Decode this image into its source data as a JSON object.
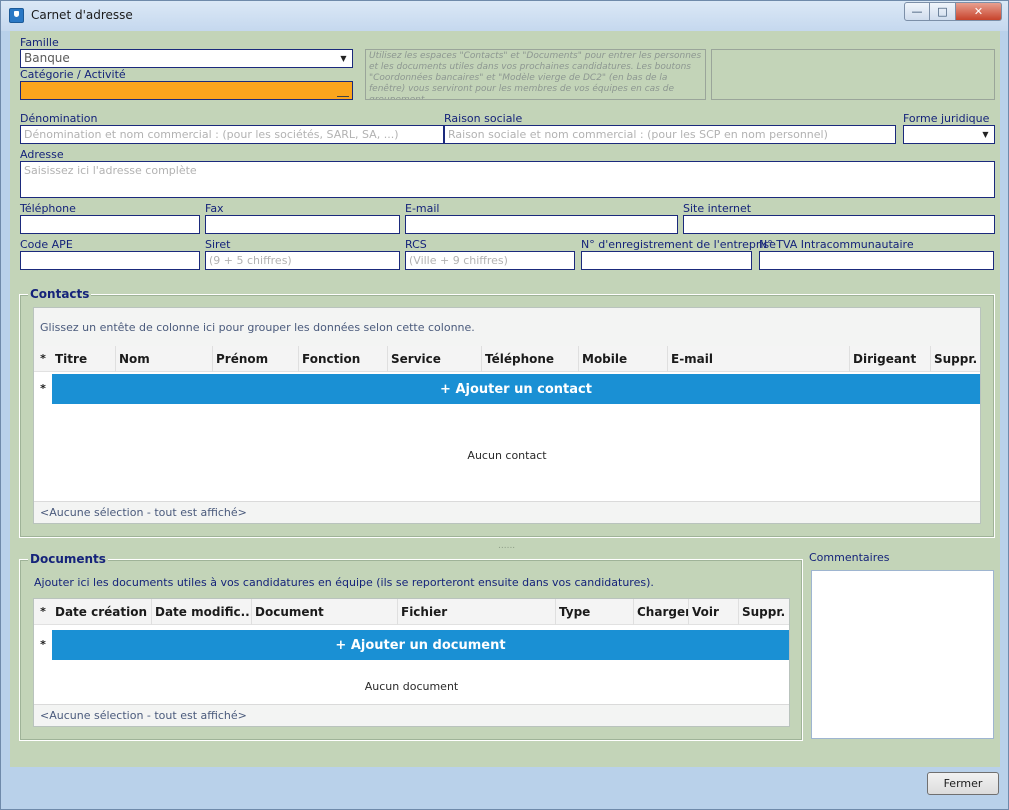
{
  "window": {
    "title": "Carnet d'adresse",
    "close_glyph": "✕",
    "minimize_glyph": "—",
    "maximize_glyph": "□"
  },
  "form": {
    "famille_label": "Famille",
    "famille_value": "Banque",
    "categorie_label": "Catégorie / Activité",
    "info_text": "Utilisez les espaces \"Contacts\" et \"Documents\" pour entrer les personnes et les documents utiles dans vos prochaines candidatures. Les boutons \"Coordonnées bancaires\" et \"Modèle vierge de DC2\" (en bas de la fenêtre) vous serviront pour les membres de vos équipes en cas de groupement.",
    "denomination_label": "Dénomination",
    "denomination_placeholder": "Dénomination et nom commercial :  (pour les sociétés, SARL, SA, ...)",
    "raison_label": "Raison sociale",
    "raison_placeholder": "Raison sociale et nom commercial : (pour les SCP en nom personnel)",
    "forme_label": "Forme juridique",
    "adresse_label": "Adresse",
    "adresse_placeholder": "Saisissez ici l'adresse complète",
    "telephone_label": "Téléphone",
    "fax_label": "Fax",
    "email_label": "E-mail",
    "site_label": "Site internet",
    "ape_label": "Code APE",
    "siret_label": "Siret",
    "siret_placeholder": "(9 + 5 chiffres)",
    "rcs_label": "RCS",
    "rcs_placeholder": "(Ville + 9 chiffres)",
    "enregistrement_label": "N° d'enregistrement de l'entreprise",
    "tva_label": "N° TVA Intracommunautaire"
  },
  "contacts": {
    "title": "Contacts",
    "hint": "Glissez un entête de colonne ici pour grouper les données selon cette colonne.",
    "star": "*",
    "columns": [
      "Titre",
      "Nom",
      "Prénom",
      "Fonction",
      "Service",
      "Téléphone",
      "Mobile",
      "E-mail",
      "Dirigeant",
      "Suppr."
    ],
    "add_label": "+ Ajouter un contact",
    "empty": "Aucun contact",
    "footer": "<Aucune sélection - tout est affiché>"
  },
  "documents": {
    "title": "Documents",
    "hint": "Ajouter ici les documents utiles à vos candidatures en équipe (ils se reporteront ensuite dans vos candidatures).",
    "star": "*",
    "columns": [
      "Date création",
      "Date modific...",
      "Document",
      "Fichier",
      "Type",
      "Charger",
      "Voir",
      "Suppr."
    ],
    "add_label": "+ Ajouter un document",
    "empty": "Aucun document",
    "footer": "<Aucune sélection - tout est affiché>"
  },
  "comments": {
    "label": "Commentaires"
  },
  "splitter_glyph": "......",
  "footer": {
    "close_label": "Fermer"
  },
  "colors": {
    "accent": "#1a90d4",
    "highlight": "#fba51d",
    "panel": "#c3d4b8",
    "label": "#15237a"
  }
}
